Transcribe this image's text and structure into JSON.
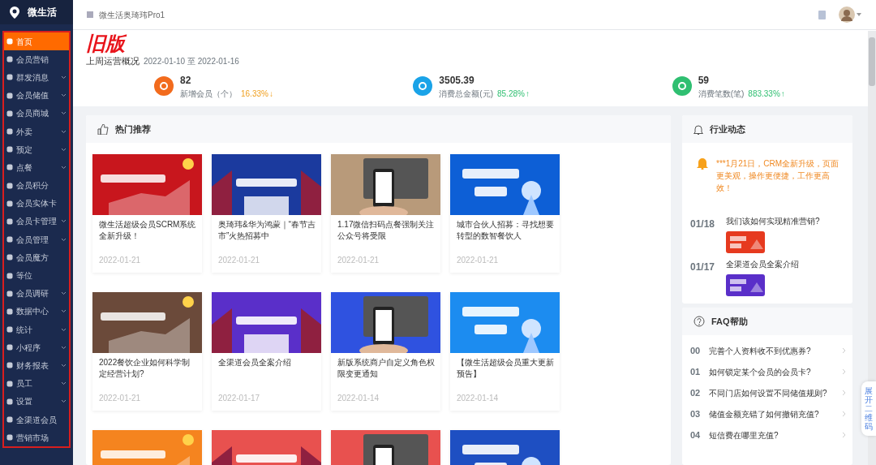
{
  "sidebar": {
    "brand": "微生活",
    "items": [
      {
        "label": "首页",
        "selected": true,
        "expandable": false
      },
      {
        "label": "会员营销",
        "selected": false,
        "expandable": false
      },
      {
        "label": "群发消息",
        "selected": false,
        "expandable": true
      },
      {
        "label": "会员储值",
        "selected": false,
        "expandable": true
      },
      {
        "label": "会员商城",
        "selected": false,
        "expandable": true
      },
      {
        "label": "外卖",
        "selected": false,
        "expandable": true
      },
      {
        "label": "预定",
        "selected": false,
        "expandable": true
      },
      {
        "label": "点餐",
        "selected": false,
        "expandable": true
      },
      {
        "label": "会员积分",
        "selected": false,
        "expandable": false
      },
      {
        "label": "会员实体卡",
        "selected": false,
        "expandable": false
      },
      {
        "label": "会员卡管理",
        "selected": false,
        "expandable": true
      },
      {
        "label": "会员管理",
        "selected": false,
        "expandable": true
      },
      {
        "label": "会员魔方",
        "selected": false,
        "expandable": false
      },
      {
        "label": "等位",
        "selected": false,
        "expandable": false
      },
      {
        "label": "会员调研",
        "selected": false,
        "expandable": true
      },
      {
        "label": "数据中心",
        "selected": false,
        "expandable": true
      },
      {
        "label": "统计",
        "selected": false,
        "expandable": true
      },
      {
        "label": "小程序",
        "selected": false,
        "expandable": true
      },
      {
        "label": "财务报表",
        "selected": false,
        "expandable": true
      },
      {
        "label": "员工",
        "selected": false,
        "expandable": true
      },
      {
        "label": "设置",
        "selected": false,
        "expandable": true
      },
      {
        "label": "全渠道会员",
        "selected": false,
        "expandable": false
      },
      {
        "label": "营销市场",
        "selected": false,
        "expandable": false
      }
    ]
  },
  "annotation": "旧版",
  "topbar": {
    "store": "微生活奥琦玮Pro1"
  },
  "overview": {
    "title": "上周运营概况",
    "range": "2022-01-10 至 2022-01-16",
    "stats": [
      {
        "value": "82",
        "label": "新增会员（个）",
        "change": {
          "text": "16.33%",
          "arrow": "↓",
          "color": "#f0a020"
        },
        "color": "#f26b1d"
      },
      {
        "value": "3505.39",
        "label": "消费总金额(元)",
        "change": {
          "text": "85.28%",
          "arrow": "↑",
          "color": "#2fbf71"
        },
        "color": "#1aa3e8"
      },
      {
        "value": "59",
        "label": "消费笔数(笔)",
        "change": {
          "text": "883.33%",
          "arrow": "↑",
          "color": "#2fbf71"
        },
        "color": "#2fbf71"
      }
    ]
  },
  "hot": {
    "title": "热门推荐",
    "articles": [
      {
        "title": "微生活超级会员SCRM系统全新升级！",
        "date": "2022-01-21",
        "color": "#c8161d"
      },
      {
        "title": "奥琦玮&华为鸿蒙｜“春节吉市”火热招募中",
        "date": "2022-01-21",
        "color": "#1b3a9e"
      },
      {
        "title": "1.17微信扫码点餐强制关注公众号将受限",
        "date": "2022-01-21",
        "color": "#b89a7a"
      },
      {
        "title": "城市合伙人招募：寻找想要转型的数智餐饮人",
        "date": "2022-01-21",
        "color": "#0d5fd6"
      },
      {
        "title": "2022餐饮企业如何科学制定经营计划?",
        "date": "2022-01-21",
        "color": "#6b4a3a"
      },
      {
        "title": "全渠道会员全案介绍",
        "date": "2022-01-17",
        "color": "#5a2fc9"
      },
      {
        "title": "新版系统商户自定义角色权限变更通知",
        "date": "2022-01-14",
        "color": "#2f52e0"
      },
      {
        "title": "【微生活超级会员重大更新预告】",
        "date": "2022-01-14",
        "color": "#1c8cf0"
      },
      {
        "color": "#f5841f"
      },
      {
        "color": "#e8514f"
      },
      {
        "color": "#e8514f"
      },
      {
        "color": "#1e4fc2"
      }
    ]
  },
  "news": {
    "title": "行业动态",
    "notice": "***1月21日，CRM全新升级，页面更美观，操作更便捷，工作更高效！",
    "items": [
      {
        "date": "01/18",
        "title": "我们该如何实现精准营销?",
        "color": "#e63a1f"
      },
      {
        "date": "01/17",
        "title": "全渠道会员全案介绍",
        "color": "#5a2fc9"
      }
    ]
  },
  "faq": {
    "title": "FAQ帮助",
    "items": [
      {
        "number": "00",
        "question": "完善个人资料收不到优惠券?"
      },
      {
        "number": "01",
        "question": "如何锁定某个会员的会员卡?"
      },
      {
        "number": "02",
        "question": "不同门店如何设置不同储值规则?"
      },
      {
        "number": "03",
        "question": "储值金额充错了如何撤销充值?"
      },
      {
        "number": "04",
        "question": "短信费在哪里充值?"
      }
    ]
  },
  "qr_tab": "展开二维码"
}
